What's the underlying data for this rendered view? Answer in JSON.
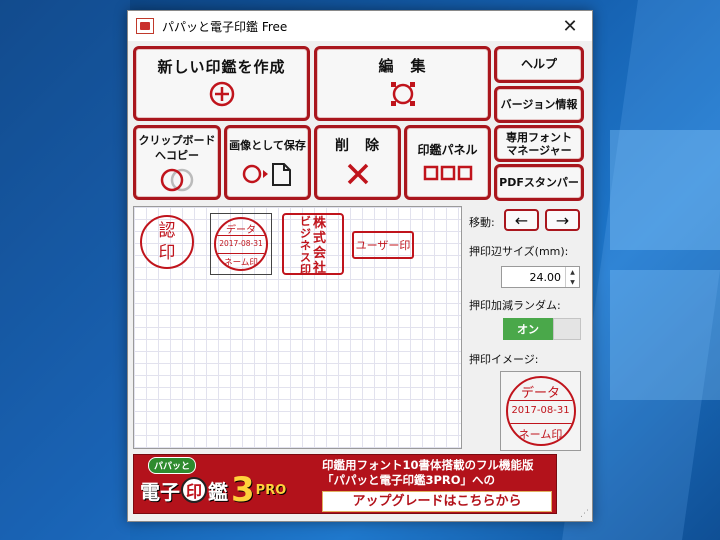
{
  "window": {
    "title": "パパッと電子印鑑 Free",
    "close_label": "✕"
  },
  "buttons": {
    "new": "新しい印鑑を作成",
    "edit": "編　集",
    "help": "ヘルプ",
    "version": "バージョン情報",
    "clip_1": "クリップボード",
    "clip_2": "へコピー",
    "save_image": "画像として保存",
    "delete": "削　除",
    "stamp_panel": "印鑑パネル",
    "font_mgr_1": "専用フォント",
    "font_mgr_2": "マネージャー",
    "pdf": "PDFスタンパー"
  },
  "stamps": {
    "mitome": [
      "認",
      "印"
    ],
    "date_top": "データ",
    "date_mid": "2017-08-31",
    "date_bottom": "ネーム印",
    "company_col1": [
      "株",
      "式",
      "会",
      "社"
    ],
    "company_col2": [
      "ビ",
      "ジ",
      "ネ",
      "ス",
      "印"
    ],
    "user_stamp": "ユーザー印"
  },
  "sidebar": {
    "move_label": "移動:",
    "left_arrow": "←",
    "right_arrow": "→",
    "size_label": "押印辺サイズ(mm):",
    "size_value": "24.00",
    "random_label": "押印加減ランダム:",
    "toggle_on": "オン",
    "preview_label": "押印イメージ:"
  },
  "preview": {
    "top": "データ",
    "mid": "2017-08-31",
    "bottom": "ネーム印"
  },
  "banner": {
    "logo_small": "パパッと",
    "logo_main": "電子",
    "logo_in": "印",
    "logo_kan": "鑑",
    "logo_num": "3",
    "logo_pro": "PRO",
    "line1": "印鑑用フォント10書体搭載のフル機能版",
    "line2": "「パパッと電子印鑑3PRO」への",
    "cta": "アップグレードはこちらから"
  },
  "colors": {
    "accent": "#a9161d",
    "stamp_red": "#c0141c",
    "toggle_green": "#4aa84a"
  }
}
